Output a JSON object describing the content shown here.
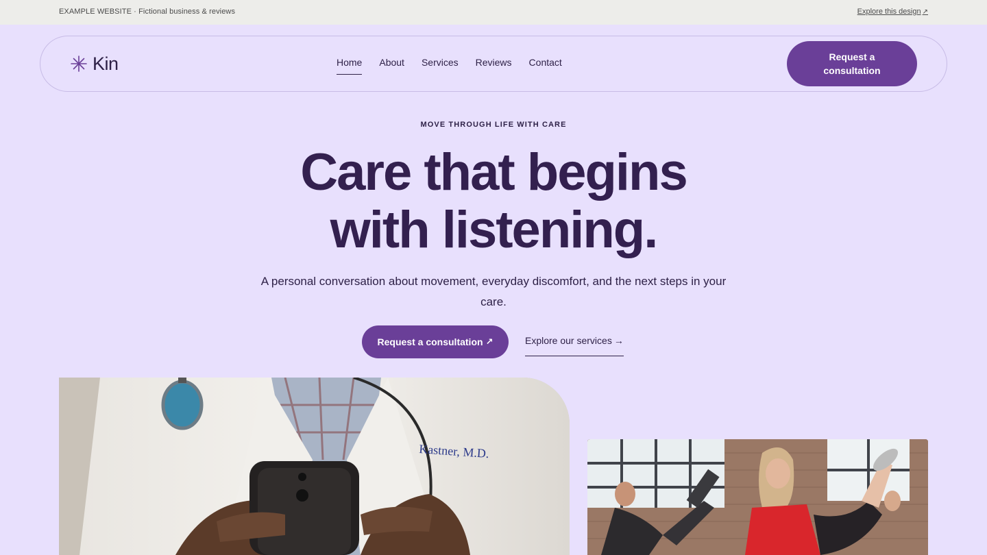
{
  "banner": {
    "left_text": "EXAMPLE WEBSITE · Fictional business & reviews",
    "right_link": "Explore this design",
    "right_arrow": "↗"
  },
  "nav": {
    "logo_icon": "asterisk-star-icon",
    "logo_text": "Kin",
    "items": [
      {
        "label": "Home",
        "active": true
      },
      {
        "label": "About",
        "active": false
      },
      {
        "label": "Services",
        "active": false
      },
      {
        "label": "Reviews",
        "active": false
      },
      {
        "label": "Contact",
        "active": false
      }
    ],
    "cta_label": "Request a consultation"
  },
  "hero": {
    "eyebrow": "MOVE THROUGH LIFE WITH CARE",
    "headline_line1": "Care that begins",
    "headline_line2": "with listening.",
    "subtitle": "A personal conversation about movement, everyday discomfort, and the next steps in your care.",
    "primary_cta": "Request a consultation",
    "primary_cta_arrow": "↗",
    "secondary_cta": "Explore our services",
    "secondary_cta_arrow": "→"
  },
  "images": {
    "doctor": "doctor-holding-phone-photo",
    "fitness": "women-exercising-photo"
  },
  "colors": {
    "page_bg": "#e8e0fd",
    "banner_bg": "#ededea",
    "accent": "#6a3f98",
    "text": "#2e2147"
  }
}
